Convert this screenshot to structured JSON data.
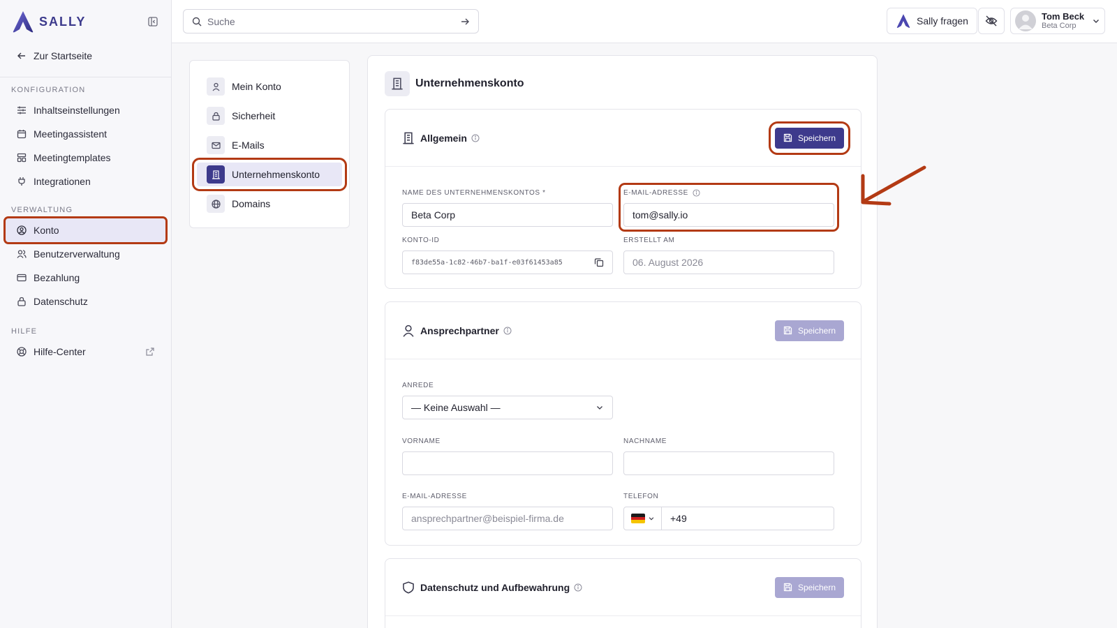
{
  "app": {
    "brand": "SALLY"
  },
  "sidebar": {
    "back_label": "Zur Startseite",
    "sections": [
      {
        "title": "KONFIGURATION",
        "items": [
          "Inhaltseinstellungen",
          "Meetingassistent",
          "Meetingtemplates",
          "Integrationen"
        ]
      },
      {
        "title": "VERWALTUNG",
        "items": [
          "Konto",
          "Benutzerverwaltung",
          "Bezahlung",
          "Datenschutz"
        ]
      },
      {
        "title": "HILFE",
        "items": [
          "Hilfe-Center"
        ]
      }
    ],
    "active_item": "Konto"
  },
  "topbar": {
    "search_placeholder": "Suche",
    "ask_label": "Sally fragen",
    "user_name": "Tom Beck",
    "user_org": "Beta Corp"
  },
  "subnav": {
    "items": [
      "Mein Konto",
      "Sicherheit",
      "E-Mails",
      "Unternehmenskonto",
      "Domains"
    ],
    "active": "Unternehmenskonto"
  },
  "page": {
    "title": "Unternehmenskonto"
  },
  "general": {
    "title": "Allgemein",
    "save_label": "Speichern",
    "name_label": "NAME DES UNTERNEHMENSKONTOS *",
    "name_value": "Beta Corp",
    "email_label": "E-MAIL-ADRESSE",
    "email_value": "tom@sally.io",
    "id_label": "KONTO-ID",
    "id_value": "f83de55a-1c82-46b7-ba1f-e03f61453a85",
    "created_label": "ERSTELLT AM",
    "created_value": "06. August 2026"
  },
  "contact": {
    "title": "Ansprechpartner",
    "save_label": "Speichern",
    "salutation_label": "ANREDE",
    "salutation_value": "— Keine Auswahl —",
    "firstname_label": "VORNAME",
    "lastname_label": "NACHNAME",
    "email_label": "E-MAIL-ADRESSE",
    "email_placeholder": "ansprechpartner@beispiel-firma.de",
    "phone_label": "TELEFON",
    "phone_prefix": "+49"
  },
  "privacy": {
    "title": "Datenschutz und Aufbewahrung",
    "save_label": "Speichern"
  },
  "colors": {
    "accent": "#3d3a8c",
    "highlight": "#b33a14"
  }
}
